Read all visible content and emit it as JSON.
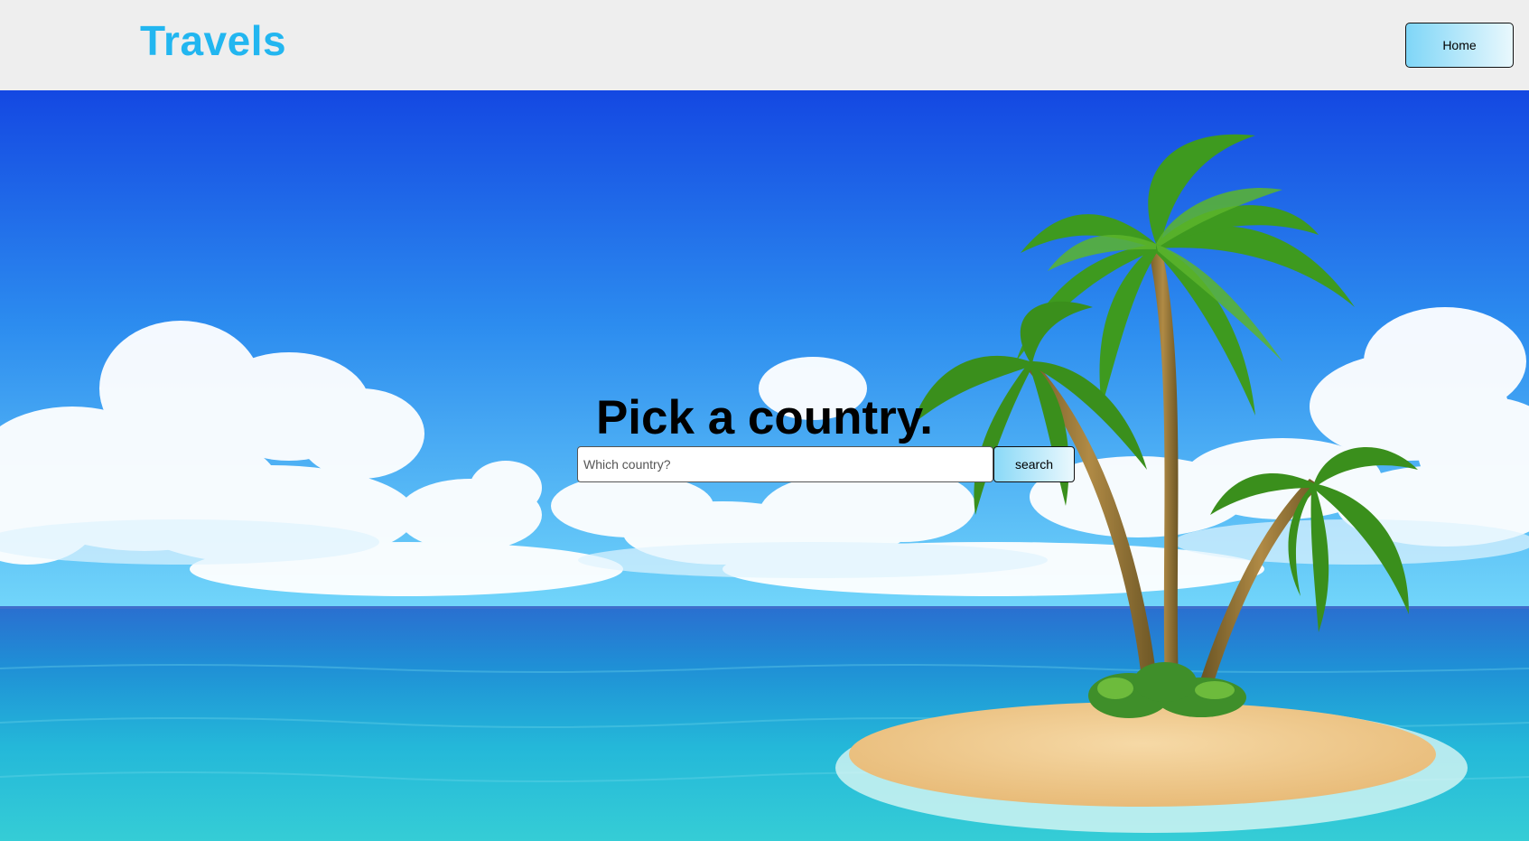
{
  "header": {
    "brand": "Travels",
    "home_label": "Home"
  },
  "hero": {
    "title": "Pick a country.",
    "search_placeholder": "Which country?",
    "search_label": "search",
    "background_image": "tropical island with palm trees, ocean and clouds"
  },
  "colors": {
    "brand": "#22b6f0",
    "header_bg": "#eeeeee",
    "sky_top": "#1448e2",
    "sky_bottom": "#6dd2f8",
    "sea": "#22b4d8",
    "sand": "#f1cf97",
    "palm_leaf": "#3e9a1f"
  }
}
